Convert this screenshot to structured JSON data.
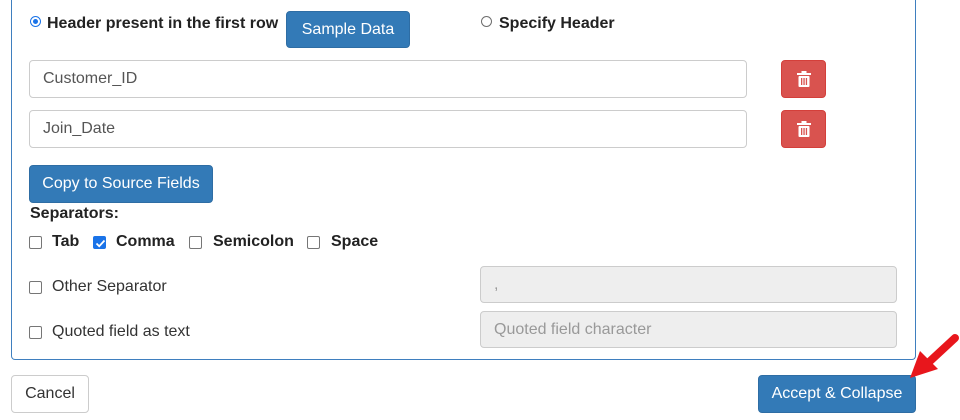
{
  "header_options": {
    "first_row_label": "Header present in the first row",
    "first_row_selected": true,
    "sample_data_label": "Sample Data",
    "specify_header_label": "Specify Header",
    "specify_header_selected": false
  },
  "fields": [
    {
      "value": "Customer_ID",
      "delete_icon": "trash-icon"
    },
    {
      "value": "Join_Date",
      "delete_icon": "trash-icon"
    }
  ],
  "copy_button_label": "Copy to Source Fields",
  "separators": {
    "heading": "Separators:",
    "options": [
      {
        "label": "Tab",
        "checked": false
      },
      {
        "label": "Comma",
        "checked": true
      },
      {
        "label": "Semicolon",
        "checked": false
      },
      {
        "label": "Space",
        "checked": false
      }
    ]
  },
  "other_separator": {
    "label": "Other Separator",
    "checked": false,
    "value": ","
  },
  "quoted_field": {
    "label": "Quoted field as text",
    "checked": false,
    "placeholder": "Quoted field character"
  },
  "footer": {
    "cancel_label": "Cancel",
    "accept_label": "Accept & Collapse"
  },
  "colors": {
    "primary": "#337ab7",
    "danger": "#d9534f",
    "annotation_arrow": "#e8161c"
  }
}
